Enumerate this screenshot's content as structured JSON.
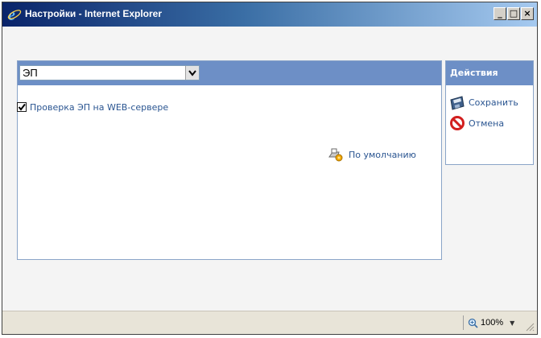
{
  "window": {
    "title": "Настройки - Internet Explorer",
    "minimize_glyph": "_",
    "maximize_glyph": "□",
    "close_glyph": "×"
  },
  "main": {
    "select": {
      "value": "ЭП"
    },
    "checkbox": {
      "label": "Проверка ЭП на WEB-сервере",
      "checked": true
    },
    "default_link": {
      "label": "По умолчанию",
      "icon": "restore-defaults-icon"
    }
  },
  "actions": {
    "title": "Действия",
    "items": [
      {
        "label": "Сохранить",
        "icon": "floppy-disk-icon"
      },
      {
        "label": "Отмена",
        "icon": "prohibited-icon"
      }
    ]
  },
  "statusbar": {
    "zoom": "100%"
  },
  "colors": {
    "panel_header": "#6d8fc6",
    "link_text": "#2a5591",
    "titlebar_start": "#0a246a",
    "titlebar_end": "#a6caf0"
  }
}
